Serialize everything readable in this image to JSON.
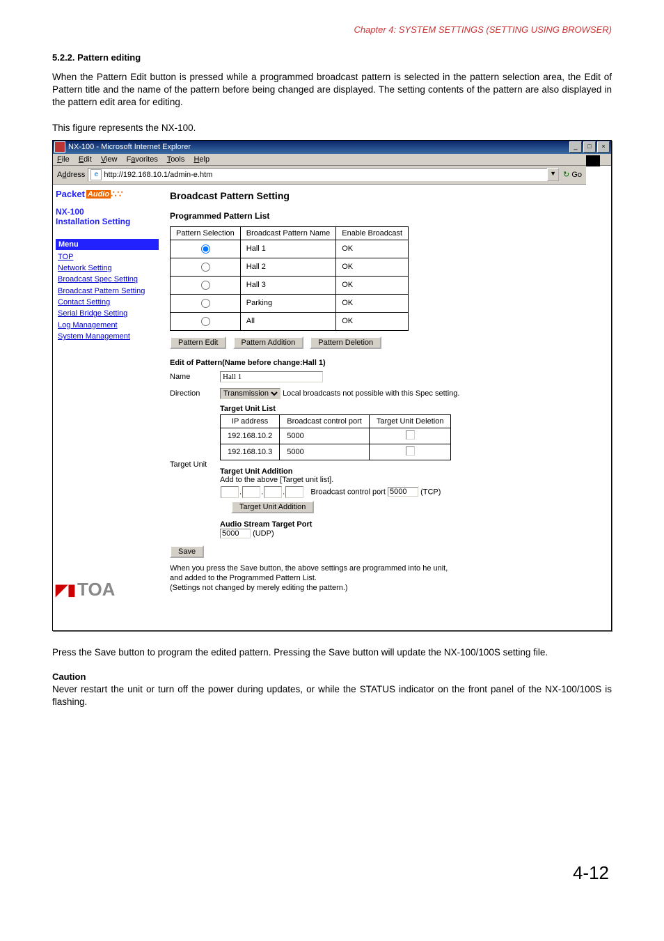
{
  "chapter_header": "Chapter 4:  SYSTEM SETTINGS (SETTING USING BROWSER)",
  "section_number_title": "5.2.2. Pattern editing",
  "para1": "When the Pattern Edit button is pressed while a programmed broadcast pattern is selected in the pattern selection area, the Edit of Pattern title and the name of the pattern before being changed are displayed. The setting contents of the pattern are also displayed in the pattern edit area for editing.",
  "para2": "This figure represents the NX-100.",
  "ie": {
    "title": "NX-100 - Microsoft Internet Explorer",
    "menu": {
      "file": "File",
      "edit": "Edit",
      "view": "View",
      "favorites": "Favorites",
      "tools": "Tools",
      "help": "Help"
    },
    "address_label": "Address",
    "address_value": "http://192.168.10.1/admin-e.htm",
    "go": "Go"
  },
  "sidebar": {
    "packet": "Packet",
    "audio": "Audio",
    "model": "NX-100",
    "install": "Installation Setting",
    "menu_header": "Menu",
    "links": [
      "TOP",
      "Network Setting",
      "Broadcast Spec Setting",
      "Broadcast Pattern Setting",
      "Contact Setting",
      "Serial Bridge Setting",
      "Log Management",
      "System Management"
    ],
    "toa": "TOA"
  },
  "main": {
    "title": "Broadcast Pattern Setting",
    "list_title": "Programmed Pattern List",
    "cols": {
      "sel": "Pattern Selection",
      "name": "Broadcast Pattern Name",
      "enable": "Enable Broadcast"
    },
    "rows": [
      {
        "name": "Hall 1",
        "enable": "OK"
      },
      {
        "name": "Hall 2",
        "enable": "OK"
      },
      {
        "name": "Hall 3",
        "enable": "OK"
      },
      {
        "name": "Parking",
        "enable": "OK"
      },
      {
        "name": "All",
        "enable": "OK"
      }
    ],
    "btn_edit": "Pattern Edit",
    "btn_add": "Pattern Addition",
    "btn_del": "Pattern Deletion",
    "edit_title": "Edit of Pattern(Name before change:Hall 1)",
    "lbl_name": "Name",
    "val_name": "Hall 1",
    "lbl_dir": "Direction",
    "val_dir": "Transmission",
    "dir_note": "Local broadcasts not possible with this Spec setting.",
    "lbl_target": "Target Unit",
    "tul_title": "Target Unit List",
    "tul_cols": {
      "ip": "IP address",
      "port": "Broadcast control port",
      "del": "Target Unit Deletion"
    },
    "tul_rows": [
      {
        "ip": "192.168.10.2",
        "port": "5000"
      },
      {
        "ip": "192.168.10.3",
        "port": "5000"
      }
    ],
    "tua_title": "Target Unit Addition",
    "tua_note": "Add to the above [Target unit list].",
    "tua_port_lbl": "Broadcast control port",
    "tua_port_val": "5000",
    "tua_tcp": "(TCP)",
    "tua_btn": "Target Unit Addition",
    "astp_title": "Audio Stream Target Port",
    "astp_val": "5000",
    "astp_udp": "(UDP)",
    "save": "Save",
    "save_note1": "When you press the Save button, the above settings are programmed into he unit,",
    "save_note2": "and added to the Programmed Pattern List.",
    "save_note3": "(Settings not changed by merely editing the pattern.)"
  },
  "para3": "Press the Save button to program the edited pattern. Pressing the Save button will update the NX-100/100S setting file.",
  "caution_label": "Caution",
  "caution_text": "Never restart the unit or turn off the power during updates, or while the STATUS indicator on the front panel of the NX-100/100S is flashing.",
  "page_number": "4-12"
}
